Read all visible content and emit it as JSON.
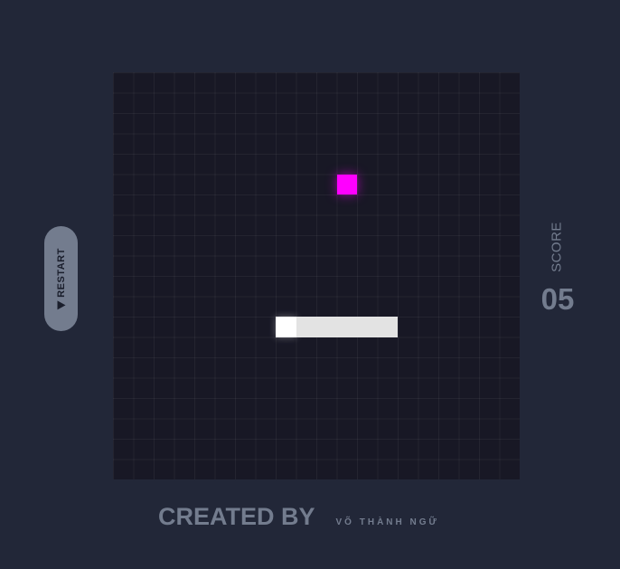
{
  "game": {
    "grid": {
      "cols": 20,
      "rows": 20
    },
    "food": {
      "col": 11,
      "row": 5,
      "color": "#ff00ff"
    },
    "snake": [
      {
        "col": 8,
        "row": 12
      },
      {
        "col": 9,
        "row": 12
      },
      {
        "col": 10,
        "row": 12
      },
      {
        "col": 11,
        "row": 12
      },
      {
        "col": 12,
        "row": 12
      },
      {
        "col": 13,
        "row": 12
      }
    ],
    "colors": {
      "background": "#222738",
      "board": "#181825",
      "snake_body": "#e3e3e3",
      "snake_head": "#ffffff",
      "muted_text": "#737c8e"
    }
  },
  "controls": {
    "restart_label": "RESTART",
    "restart_icon": "play-icon"
  },
  "score": {
    "label": "SCORE",
    "value": "05"
  },
  "footer": {
    "created_by": "CREATED BY",
    "author": "VÕ THÀNH NGỮ"
  }
}
